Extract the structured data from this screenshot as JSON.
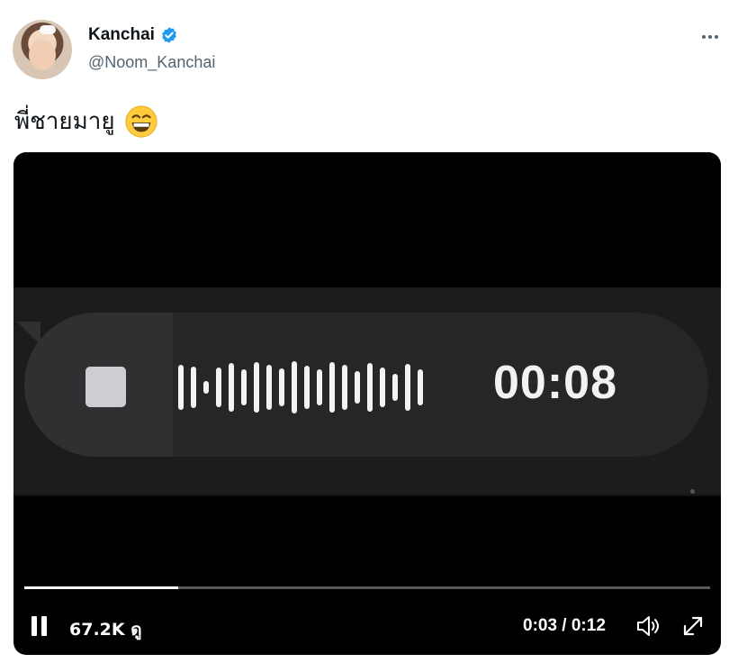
{
  "author": {
    "display_name": "Kanchai",
    "handle": "@Noom_Kanchai",
    "verified": true,
    "verified_color": "#1d9bf0"
  },
  "tweet": {
    "text": "พี่ชายมายู",
    "emoji": "grinning-face-with-smiling-eyes"
  },
  "video": {
    "recording_time": "00:08",
    "views": "67.2K ดู",
    "time": "0:03 / 0:12",
    "progress": 0.225,
    "state": "playing",
    "icons": [
      "pause-icon",
      "volume-icon",
      "fullscreen-icon",
      "stop-icon",
      "more-icon"
    ]
  },
  "colors": {
    "text": "#0f1419",
    "secondary": "#536471",
    "media_bg": "#000000"
  }
}
